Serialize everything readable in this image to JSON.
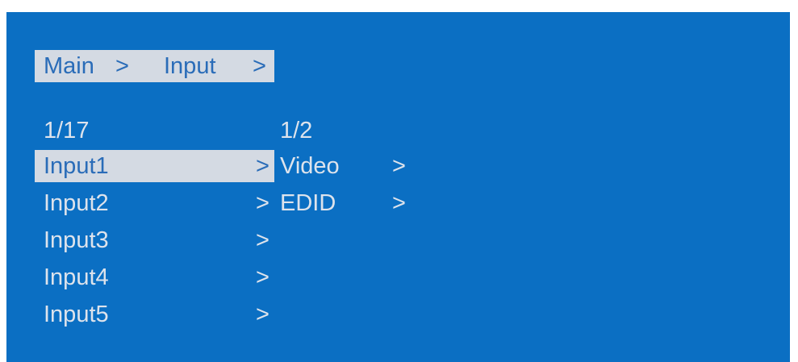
{
  "breadcrumb": {
    "main": "Main",
    "sep1": ">",
    "input": "Input",
    "sep2": ">"
  },
  "input_list": {
    "page": "1/17",
    "items": [
      {
        "label": "Input1",
        "arrow": ">"
      },
      {
        "label": "Input2",
        "arrow": ">"
      },
      {
        "label": "Input3",
        "arrow": ">"
      },
      {
        "label": "Input4",
        "arrow": ">"
      },
      {
        "label": "Input5",
        "arrow": ">"
      }
    ]
  },
  "submenu": {
    "page": "1/2",
    "items": [
      {
        "label": "Video",
        "arrow": ">"
      },
      {
        "label": "EDID",
        "arrow": ">"
      }
    ]
  },
  "colors": {
    "background": "#0b6fc3",
    "text": "#dde3ec",
    "highlight_bg": "#d4dae3",
    "highlight_text": "#2a6cb8"
  }
}
